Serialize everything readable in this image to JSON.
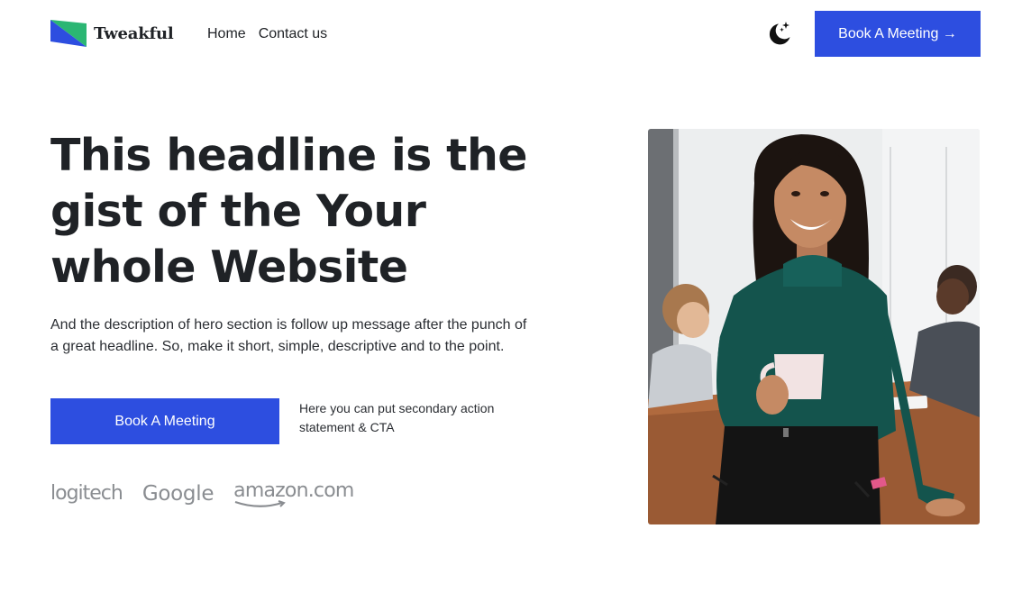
{
  "brand": {
    "name": "Tweakful",
    "accent": "#2d4ee0",
    "logo_colors": [
      "#2d4ee0",
      "#2bb673"
    ]
  },
  "nav": {
    "items": [
      {
        "label": "Home"
      },
      {
        "label": "Contact us"
      }
    ]
  },
  "header": {
    "cta_label": "Book A Meeting →",
    "theme_icon": "moon-stars-icon"
  },
  "hero": {
    "headline": "This headline is the gist of the Your whole Website",
    "description": "And the description of hero section is follow up message after the punch of a great headline. So, make it short, simple, descriptive and to the point.",
    "primary_cta": "Book A Meeting",
    "secondary_note": "Here you can put secondary action statement & CTA"
  },
  "brands": [
    "logitech",
    "Google",
    "amazon.com"
  ]
}
